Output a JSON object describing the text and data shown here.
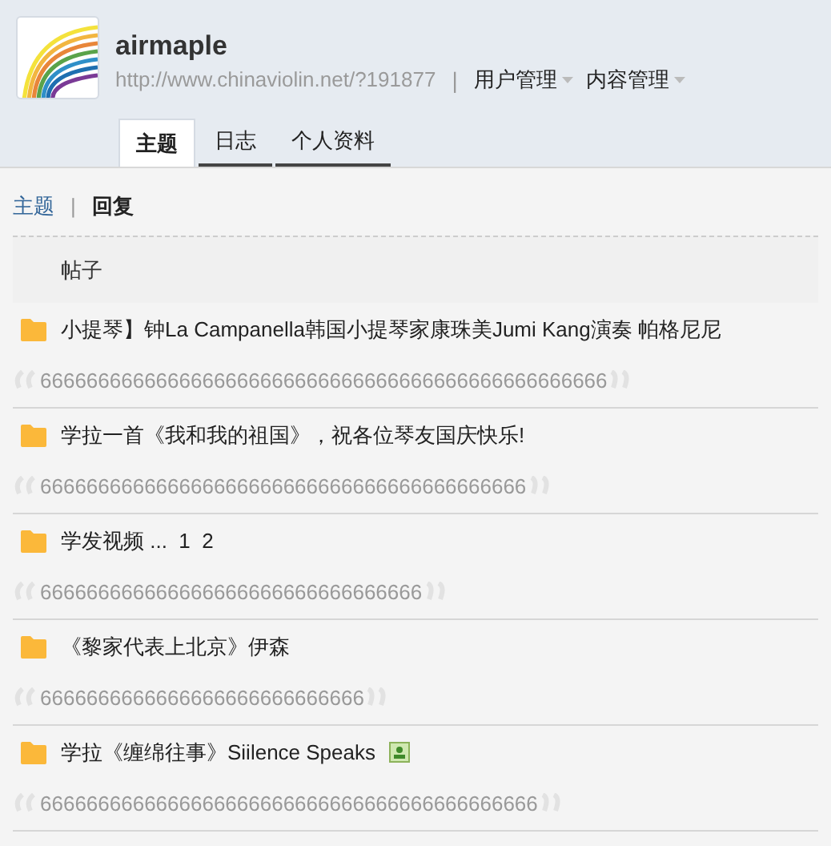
{
  "profile": {
    "name": "airmaple",
    "url": "http://www.chinaviolin.net/?191877",
    "separator": "|",
    "menus": [
      {
        "label": "用户管理"
      },
      {
        "label": "内容管理"
      }
    ]
  },
  "tabs": [
    {
      "label": "主题",
      "selected": true
    },
    {
      "label": "日志",
      "selected": false
    },
    {
      "label": "个人资料",
      "selected": false
    }
  ],
  "subnav": [
    {
      "label": "主题",
      "selected": false
    },
    {
      "label": "回复",
      "selected": true
    }
  ],
  "subnav_separator": "|",
  "list_header": "帖子",
  "posts": [
    {
      "title": "小提琴】钟La Campanella韩国小提琴家康珠美Jumi Kang演奏 帕格尼尼",
      "has_image": false,
      "reply": "6666666666666666666666666666666666666666666666666"
    },
    {
      "title": "学拉一首《我和我的祖国》，祝各位琴友国庆快乐!",
      "has_image": false,
      "reply": "666666666666666666666666666666666666666666"
    },
    {
      "title": "学发视频 ...  1  2",
      "has_image": false,
      "reply": "666666666666666666666666666666666"
    },
    {
      "title": "《黎家代表上北京》伊森",
      "has_image": false,
      "reply": "6666666666666666666666666666"
    },
    {
      "title": "学拉《缠绵往事》Siilence Speaks",
      "has_image": true,
      "reply": "6666666666666666666666666666666666666666666"
    }
  ]
}
